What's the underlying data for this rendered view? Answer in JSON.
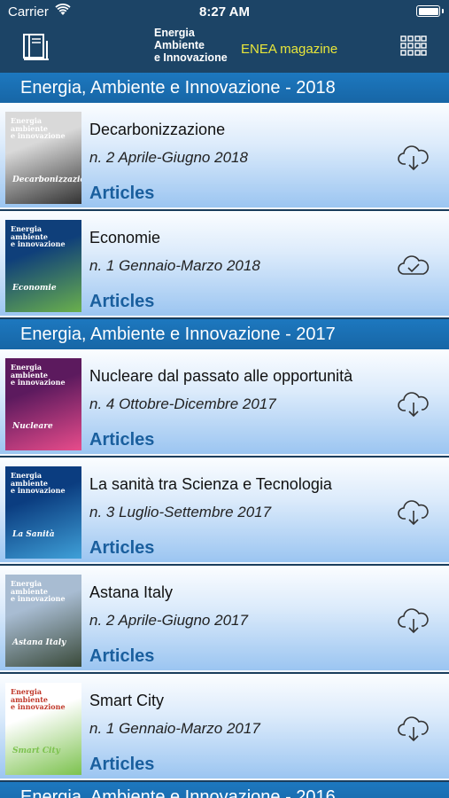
{
  "status_bar": {
    "carrier": "Carrier",
    "time": "8:27 AM"
  },
  "nav": {
    "logo_lines": [
      "Energia",
      "Ambiente",
      "e Innovazione"
    ],
    "title": "ENEA magazine"
  },
  "sections": [
    {
      "title": "Energia, Ambiente e Innovazione - 2018"
    },
    {
      "title": "Energia, Ambiente e Innovazione - 2017"
    },
    {
      "title": "Energia, Ambiente e Innovazione - 2016"
    }
  ],
  "issues": [
    {
      "title": "Decarbonizzazione",
      "issue": "n. 2 Aprile-Giugno 2018",
      "articles": "Articles",
      "status_icon": "cloud-download-icon",
      "cover_word": "Decarbonizzazione",
      "cover_colors": [
        "#d9d9d9",
        "#333333"
      ]
    },
    {
      "title": "Economie",
      "issue": "n. 1 Gennaio-Marzo 2018",
      "articles": "Articles",
      "status_icon": "cloud-check-icon",
      "cover_word": "Economie",
      "cover_colors": [
        "#0f3f7a",
        "#6ab04c"
      ]
    },
    {
      "title": "Nucleare dal passato alle opportunità",
      "issue": "n. 4 Ottobre-Dicembre 2017",
      "articles": "Articles",
      "status_icon": "cloud-download-icon",
      "cover_word": "Nucleare",
      "cover_colors": [
        "#5c1a5e",
        "#e84c8b"
      ]
    },
    {
      "title": "La sanità tra Scienza e Tecnologia",
      "issue": "n. 3 Luglio-Settembre 2017",
      "articles": "Articles",
      "status_icon": "cloud-download-icon",
      "cover_word": "La Sanità",
      "cover_colors": [
        "#0b3d80",
        "#3fa0d8"
      ]
    },
    {
      "title": "Astana Italy",
      "issue": "n. 2 Aprile-Giugno 2017",
      "articles": "Articles",
      "status_icon": "cloud-download-icon",
      "cover_word": "Astana Italy",
      "cover_colors": [
        "#a8bcd2",
        "#3a4a3a"
      ]
    },
    {
      "title": "Smart City",
      "issue": "n. 1 Gennaio-Marzo 2017",
      "articles": "Articles",
      "status_icon": "cloud-download-icon",
      "cover_word": "Smart City",
      "cover_colors": [
        "#ffffff",
        "#7cc24e"
      ]
    }
  ]
}
